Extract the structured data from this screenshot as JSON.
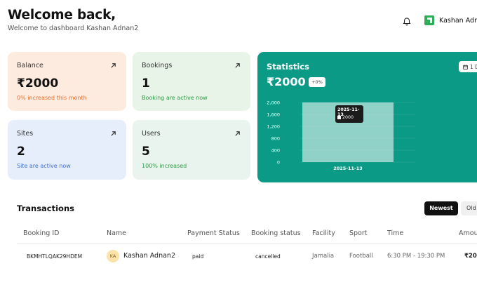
{
  "header": {
    "title": "Welcome back,",
    "subtitle": "Welcome to dashboard Kashan Adnan2",
    "user_name": "Kashan Adn"
  },
  "cards": {
    "balance": {
      "label": "Balance",
      "value": "₹2000",
      "note": "0% increased this month",
      "bg": "#fdebe0",
      "note_color": "#e8702a"
    },
    "bookings": {
      "label": "Bookings",
      "value": "1",
      "note": "Booking are active now",
      "bg": "#e9f4e9",
      "note_color": "#2e9a44"
    },
    "sites": {
      "label": "Sites",
      "value": "2",
      "note": "Site are active now",
      "bg": "#e6edfb",
      "note_color": "#3a6fd8"
    },
    "users": {
      "label": "Users",
      "value": "5",
      "note": "100% increased",
      "bg": "#e9f4ee",
      "note_color": "#2e9a44"
    }
  },
  "statistics": {
    "title": "Statistics",
    "value": "₹2000",
    "change": "+0%",
    "period": "1 D",
    "tooltip_date": "2025-11-13",
    "tooltip_value": "2000",
    "accent": "#0a9a86"
  },
  "chart_data": {
    "type": "bar",
    "categories": [
      "2025-11-13"
    ],
    "series": [
      {
        "values": [
          2000
        ]
      }
    ],
    "yticks": [
      "2,000",
      "1,600",
      "1,200",
      "800",
      "400",
      "0"
    ],
    "ylim": [
      0,
      2000
    ],
    "grid": true
  },
  "transactions": {
    "title": "Transactions",
    "sort_newest": "Newest",
    "sort_oldest": "Old",
    "columns": [
      "Booking ID",
      "Name",
      "Payment Status",
      "Booking status",
      "Facility",
      "Sport",
      "Time",
      "Amou"
    ],
    "rows": [
      {
        "booking_id": "BKMHTLQAK29HDEM",
        "initials": "KA",
        "name": "Kashan Adnan2",
        "payment_status": "paid",
        "booking_status": "cancelled",
        "facility": "Jamalia",
        "sport": "Football",
        "time": "6:30 PM - 19:30 PM",
        "amount": "₹20"
      }
    ]
  }
}
